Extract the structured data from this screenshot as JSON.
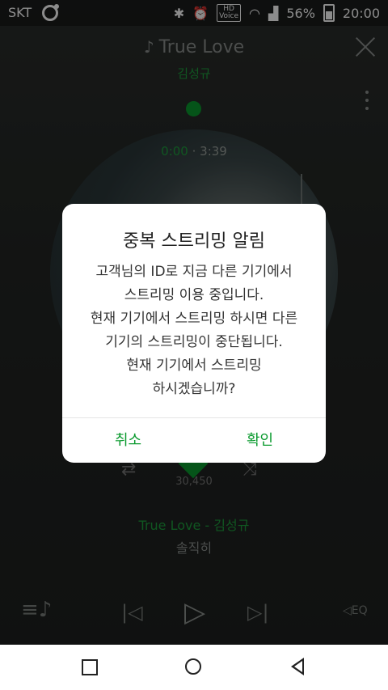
{
  "status_bar": {
    "carrier": "SKT",
    "battery_percent": "56%",
    "time": "20:00"
  },
  "player": {
    "title": "True Love",
    "artist": "김성규",
    "time_current": "0:00",
    "time_separator": " · ",
    "time_total": "3:39",
    "like_count": "30,450",
    "track_line": "True Love - 김성규",
    "lyric": "솔직히",
    "eq_label": "EQ"
  },
  "dialog": {
    "title": "중복 스트리밍 알림",
    "body_lines": [
      "고객님의 ID로 지금 다른 기기에서",
      "스트리밍 이용 중입니다.",
      "현재 기기에서 스트리밍 하시면 다른",
      "기기의 스트리밍이 중단됩니다.",
      "현재 기기에서 스트리밍",
      "하시겠습니까?"
    ],
    "cancel_label": "취소",
    "confirm_label": "확인"
  },
  "colors": {
    "accent": "#0a9a2e",
    "dialog_bg": "#ffffff"
  }
}
